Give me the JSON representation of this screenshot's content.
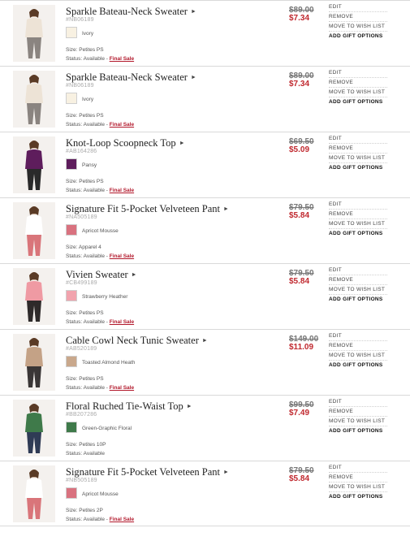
{
  "actions": {
    "edit": "EDIT",
    "remove": "REMOVE",
    "wishlist": "MOVE TO WISH LIST",
    "gift": "ADD GIFT OPTIONS"
  },
  "items": [
    {
      "name": "Sparkle Bateau-Neck Sweater",
      "sku": "#NB06189",
      "color": "Ivory",
      "swatch": "#f8f1e2",
      "size": "Size: Petites PS",
      "status_label": "Status: Available -",
      "status_link": "Final Sale",
      "old_price": "$89.00",
      "new_price": "$7.34",
      "garment": "#ede3d6",
      "bottom": "#8a8480"
    },
    {
      "name": "Sparkle Bateau-Neck Sweater",
      "sku": "#NB06189",
      "color": "Ivory",
      "swatch": "#f8f1e2",
      "size": "Size: Petites PS",
      "status_label": "Status: Available -",
      "status_link": "Final Sale",
      "old_price": "$89.00",
      "new_price": "$7.34",
      "garment": "#ede3d6",
      "bottom": "#8a8480"
    },
    {
      "name": "Knot-Loop Scoopneck Top",
      "sku": "#AB164286",
      "color": "Pansy",
      "swatch": "#5e1d5c",
      "size": "Size: Petites PS",
      "status_label": "Status: Available -",
      "status_link": "Final Sale",
      "old_price": "$69.50",
      "new_price": "$5.09",
      "garment": "#5e1d5c",
      "bottom": "#2a2a2a"
    },
    {
      "name": "Signature Fit 5-Pocket Velveteen Pant",
      "sku": "#NA505189",
      "color": "Apricot Mousse",
      "swatch": "#d9727f",
      "size": "Size: Apparel 4",
      "status_label": "Status: Available -",
      "status_link": "Final Sale",
      "old_price": "$79.50",
      "new_price": "$5.84",
      "garment": "#ffffff",
      "bottom": "#d9757a"
    },
    {
      "name": "Vivien Sweater",
      "sku": "#CB499189",
      "color": "Strawberry Heather",
      "swatch": "#f1a3ad",
      "size": "Size: Petites PS",
      "status_label": "Status: Available -",
      "status_link": "Final Sale",
      "old_price": "$79.50",
      "new_price": "$5.84",
      "garment": "#ef9aa3",
      "bottom": "#2e2a2a"
    },
    {
      "name": "Cable Cowl Neck Tunic Sweater",
      "sku": "#AB520189",
      "color": "Toasted Almond Heath",
      "swatch": "#c9a88c",
      "size": "Size: Petites PS",
      "status_label": "Status: Available -",
      "status_link": "Final Sale",
      "old_price": "$149.00",
      "new_price": "$11.09",
      "garment": "#c4a286",
      "bottom": "#3a3636"
    },
    {
      "name": "Floral Ruched Tie-Waist Top",
      "sku": "#BB207286",
      "color": "Green-Graphic Floral",
      "swatch": "#3f7a4a",
      "size": "Size: Petites 10P",
      "status_label": "Status: Available",
      "status_link": "",
      "old_price": "$99.50",
      "new_price": "$7.49",
      "garment": "#3f7a4a",
      "bottom": "#2f3b55"
    },
    {
      "name": "Signature Fit 5-Pocket Velveteen Pant",
      "sku": "#NB505189",
      "color": "Apricot Mousse",
      "swatch": "#d9727f",
      "size": "Size: Petites 2P",
      "status_label": "Status: Available -",
      "status_link": "Final Sale",
      "old_price": "$79.50",
      "new_price": "$5.84",
      "garment": "#ffffff",
      "bottom": "#d9757a"
    }
  ]
}
